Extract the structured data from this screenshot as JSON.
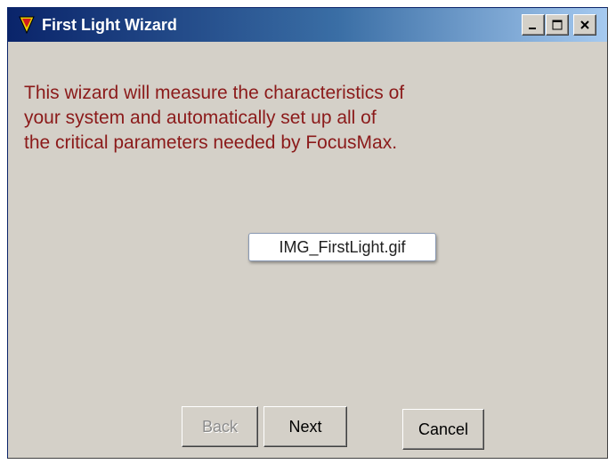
{
  "window": {
    "title": "First Light Wizard",
    "controls": {
      "minimize_icon": "minimize-icon",
      "maximize_icon": "maximize-icon",
      "close_icon": "close-icon"
    }
  },
  "content": {
    "intro_lines": [
      "This wizard will measure the characteristics of",
      "your system and automatically set up all of",
      "the critical parameters needed by FocusMax."
    ],
    "image_placeholder": "IMG_FirstLight.gif"
  },
  "buttons": {
    "back": "Back",
    "next": "Next",
    "cancel": "Cancel"
  },
  "colors": {
    "intro_text": "#8b1a1a",
    "titlebar_start": "#0a246a",
    "titlebar_end": "#a6caf0",
    "dialog_bg": "#d4d0c8"
  }
}
